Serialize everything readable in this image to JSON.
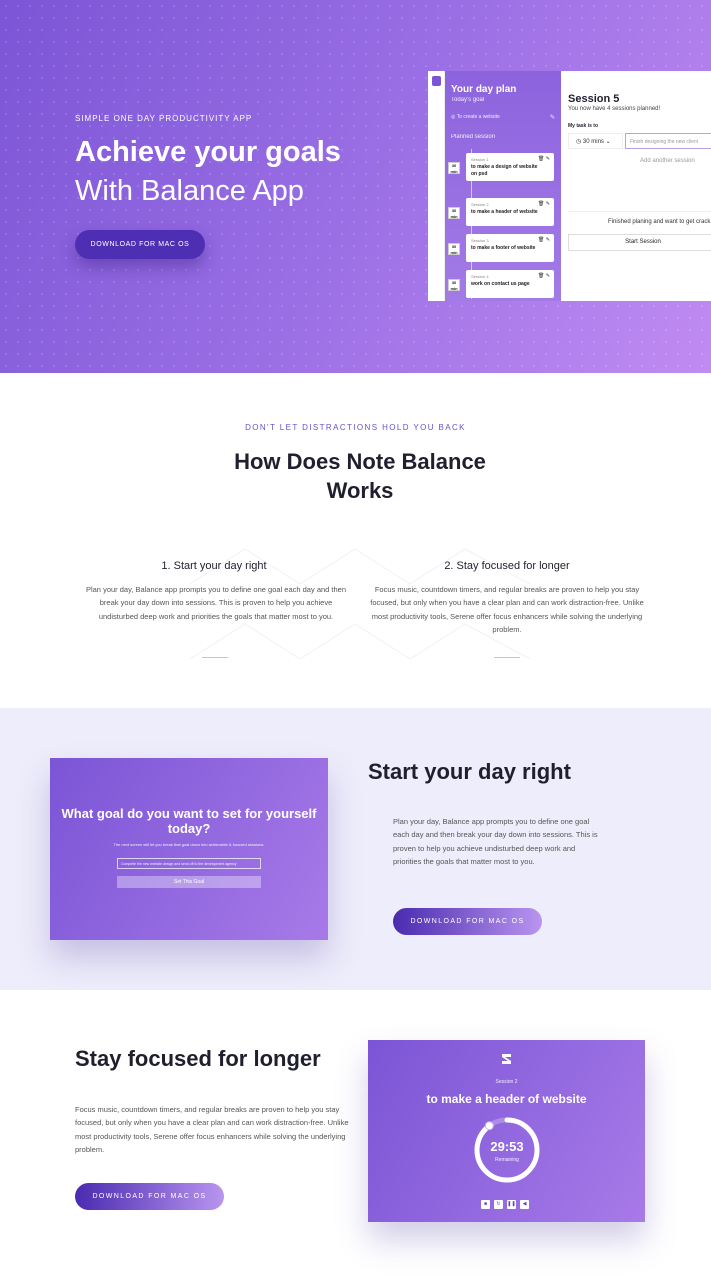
{
  "hero": {
    "eyebrow": "SIMPLE ONE DAY PRODUCTIVITY APP",
    "title_line1": "Achieve your goals",
    "title_line2": "With Balance App",
    "cta": "DOWNLOAD FOR MAC OS"
  },
  "app": {
    "day_plan_title": "Your day plan",
    "todays_goal": "Today's goal",
    "create_placeholder": "To create a website",
    "planned_label": "Planned session",
    "sessions": [
      {
        "name": "Session 1",
        "task": "to make a design of website on psd",
        "minutes": "30"
      },
      {
        "name": "Session 2",
        "task": "to make a header of website",
        "minutes": "30"
      },
      {
        "name": "Session 3",
        "task": "to make a footer of website",
        "minutes": "30"
      },
      {
        "name": "Session 4",
        "task": "work on contact us page",
        "minutes": "30"
      }
    ],
    "minutes_unit": "min",
    "session_title": "Session 5",
    "sessions_planned": "You now have 4 sessions planned!",
    "my_task_label": "My task is to",
    "duration": "30 mins",
    "task_placeholder": "Finish designing the new client",
    "add_session": "Add another session",
    "finished_text": "Finished planing and want to get crack",
    "start_button": "Start Session"
  },
  "how": {
    "eyebrow": "DON'T LET DISTRACTIONS HOLD YOU BACK",
    "title_line1": "How Does Note Balance",
    "title_line2": "Works",
    "features": [
      {
        "title": "1. Start your day right",
        "body": "Plan your day, Balance app prompts you to define one goal each day and then break your day down into sessions. This is proven to help you achieve undisturbed deep work and priorities the goals that matter most to you."
      },
      {
        "title": "2. Stay focused for longer",
        "body": "Focus music, countdown timers, and regular breaks are proven to help you stay focused, but only when you have a clear plan and can work distraction-free. Unlike most productivity tools, Serene offer focus enhancers while solving the underlying problem."
      }
    ]
  },
  "start_day": {
    "card_question": "What goal do you want to set for yourself today?",
    "card_sub": "The next screen will let you break that goal down into achievable & focused sessions.",
    "card_input": "Complete the new website design and send off to the development agency",
    "card_button": "Set This Goal",
    "title": "Start your day right",
    "body": "Plan your day, Balance app prompts you to define one goal each day and then break your day down into sessions. This is proven to help you achieve undisturbed deep work and priorities the goals that matter most to you.",
    "cta": "DOWNLOAD FOR MAC OS"
  },
  "focus": {
    "title": "Stay focused for longer",
    "body": "Focus music, countdown timers, and regular breaks are proven to help you stay focused, but only when you have a clear plan and can work distraction-free. Unlike most productivity tools, Serene offer focus enhancers while solving the underlying problem.",
    "cta": "DOWNLOAD FOR MAC OS",
    "card_session": "Session 2",
    "card_task": "to make a header of website",
    "timer": "29:53",
    "remaining": "Remaining",
    "timer_progress": 0.9
  },
  "colors": {
    "brand_purple": "#7b55d6",
    "brand_dark": "#4e2fb3",
    "section_bg": "#eeedfb"
  }
}
